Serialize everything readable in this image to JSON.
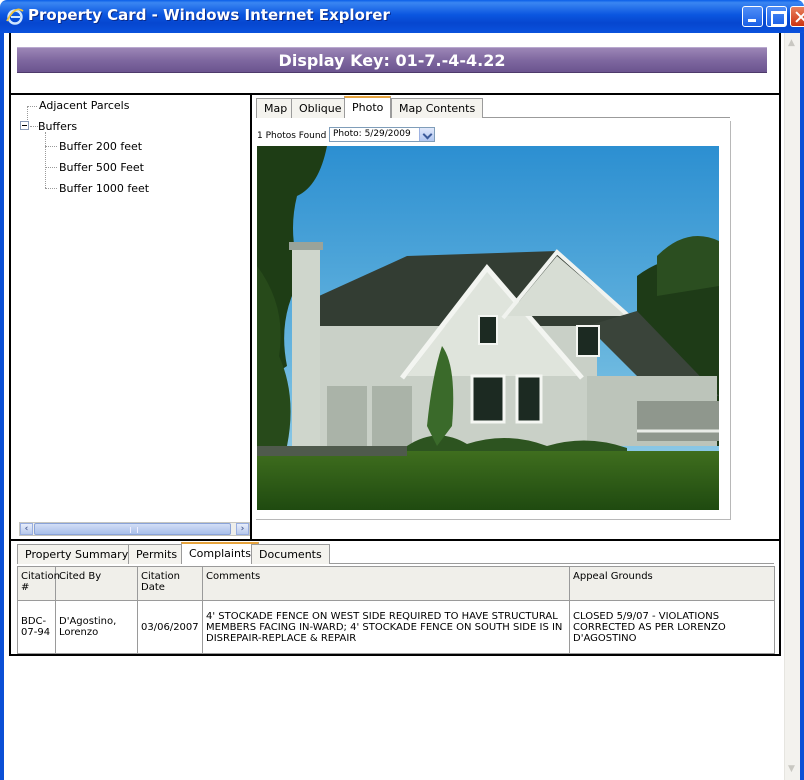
{
  "window": {
    "title": "Property Card - Windows Internet Explorer"
  },
  "header": {
    "display_key": "Display Key: 01-7.-4-4.22"
  },
  "tree": {
    "items": [
      {
        "label": "Adjacent Parcels"
      },
      {
        "label": "Buffers"
      },
      {
        "label": "Buffer 200 feet"
      },
      {
        "label": "Buffer 500 Feet"
      },
      {
        "label": "Buffer 1000 feet"
      }
    ]
  },
  "map_tabs": {
    "items": [
      "Map",
      "Oblique",
      "Photo",
      "Map Contents"
    ],
    "active": "Photo"
  },
  "photo": {
    "count_text": "1 Photos Found",
    "selected": "Photo: 5/29/2009"
  },
  "bottom_tabs": {
    "items": [
      "Property Summary",
      "Permits",
      "Complaints",
      "Documents"
    ],
    "active": "Complaints"
  },
  "complaints": {
    "headers": [
      "Citation #",
      "Cited By",
      "Citation Date",
      "Comments",
      "Appeal Grounds"
    ],
    "rows": [
      {
        "citation": "BDC-07-94",
        "cited_by": "D'Agostino, Lorenzo",
        "date": "03/06/2007",
        "comments": "4' STOCKADE FENCE ON WEST SIDE REQUIRED TO HAVE STRUCTURAL MEMBERS FACING IN-WARD; 4' STOCKADE FENCE ON SOUTH SIDE IS IN DISREPAIR-REPLACE & REPAIR",
        "appeal": "CLOSED 5/9/07 - VIOLATIONS CORRECTED AS PER LORENZO D'AGOSTINO"
      }
    ]
  },
  "colors": {
    "titlebar": "#0a52dd",
    "header_band": "#7f68a0",
    "active_tab_accent": "#e6a33c"
  }
}
